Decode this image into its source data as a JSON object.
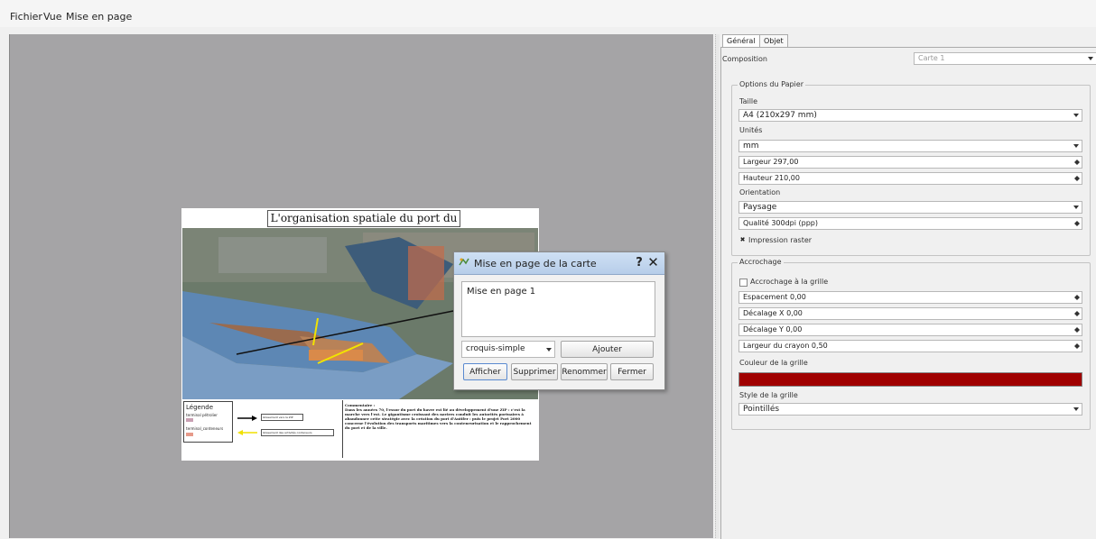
{
  "menu": {
    "items": [
      "Fichier",
      "Vue",
      "Mise en page"
    ]
  },
  "composition_page": {
    "map_title": "L'organisation spatiale du port du Havre",
    "legend": {
      "title": "Légende",
      "entries": [
        "terminal pétrolier",
        "terminal_conteneurs"
      ],
      "arrow_labels": [
        "Glissement vers la ZIP",
        "Glissement des activités conteneurs"
      ]
    },
    "comment": {
      "heading": "Commentaire :",
      "body": "Dans les années 70, l'essor du port du havre est lié au développement d'une ZIP : c'est la marche vers l'est. Le gigantisme croissant des navires conduit les autorités portuaires à abandonner cette stratégie avec la création du port d'Antifer : puis le projet Port 2000 concerne l'évolution des transports maritimes vers la conteneurisation et le rapprochement du port et de la ville."
    }
  },
  "dialog": {
    "title": "Mise en page de la carte",
    "help": "?",
    "close": "✕",
    "list_item": "Mise en page 1",
    "template_combo": "croquis-simple",
    "buttons": {
      "add": "Ajouter",
      "show": "Afficher",
      "delete": "Supprimer",
      "rename": "Renommer",
      "close": "Fermer"
    }
  },
  "panel": {
    "tabs": [
      "Général",
      "Objet"
    ],
    "composition_label": "Composition",
    "composition_value": "Carte 1",
    "paper": {
      "group_title": "Options du Papier",
      "size_label": "Taille",
      "size_value": "A4 (210x297 mm)",
      "units_label": "Unités",
      "units_value": "mm",
      "width": "Largeur 297,00",
      "height": "Hauteur 210,00",
      "orientation_label": "Orientation",
      "orientation_value": "Paysage",
      "quality": "Qualité 300dpi (ppp)",
      "raster_label": "Impression raster",
      "raster_checked": true
    },
    "snapping": {
      "group_title": "Accrochage",
      "snap_label": "Accrochage à la grille",
      "snap_checked": false,
      "spacing": "Espacement 0,00",
      "offset_x": "Décalage X 0,00",
      "offset_y": "Décalage Y 0,00",
      "pen_width": "Largeur du crayon 0,50",
      "grid_color_label": "Couleur de la grille",
      "grid_color": "#a00000",
      "grid_style_label": "Style de la grille",
      "grid_style_value": "Pointillés"
    }
  }
}
